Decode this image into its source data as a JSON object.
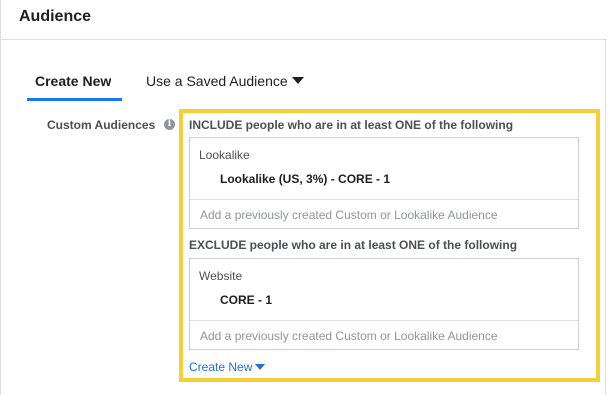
{
  "header": {
    "title": "Audience"
  },
  "tabs": [
    {
      "label": "Create New",
      "active": true
    },
    {
      "label": "Use a Saved Audience",
      "active": false
    }
  ],
  "custom_audiences": {
    "label": "Custom Audiences",
    "info_icon": "info-icon",
    "include": {
      "heading": "INCLUDE people who are in at least ONE of the following",
      "type": "Lookalike",
      "item": "Lookalike (US, 3%) - CORE - 1",
      "input_placeholder": "Add a previously created Custom or Lookalike Audience"
    },
    "exclude": {
      "heading": "EXCLUDE people who are in at least ONE of the following",
      "type": "Website",
      "item": "CORE - 1",
      "input_placeholder": "Add a previously created Custom or Lookalike Audience"
    },
    "create_new_label": "Create New"
  },
  "colors": {
    "highlight": "#f4cf37",
    "link": "#216fdb",
    "tab_underline": "#1877f2"
  }
}
